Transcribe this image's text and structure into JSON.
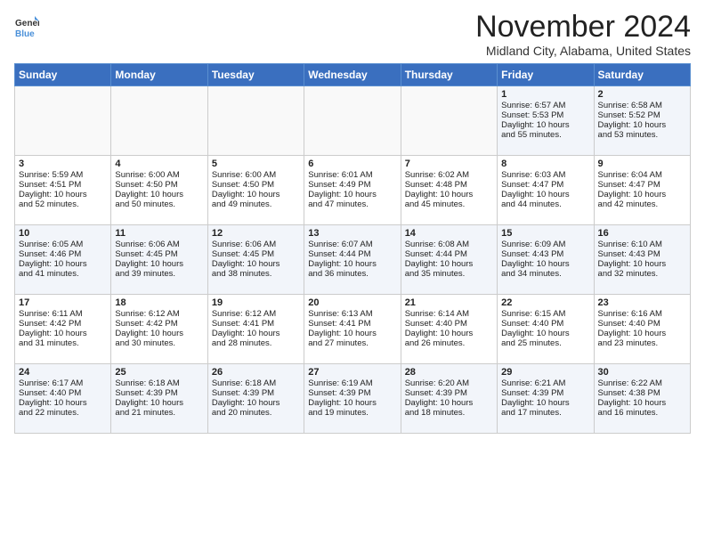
{
  "header": {
    "logo_line1": "General",
    "logo_line2": "Blue",
    "month": "November 2024",
    "location": "Midland City, Alabama, United States"
  },
  "days_of_week": [
    "Sunday",
    "Monday",
    "Tuesday",
    "Wednesday",
    "Thursday",
    "Friday",
    "Saturday"
  ],
  "weeks": [
    [
      {
        "day": "",
        "lines": []
      },
      {
        "day": "",
        "lines": []
      },
      {
        "day": "",
        "lines": []
      },
      {
        "day": "",
        "lines": []
      },
      {
        "day": "",
        "lines": []
      },
      {
        "day": "1",
        "lines": [
          "Sunrise: 6:57 AM",
          "Sunset: 5:53 PM",
          "Daylight: 10 hours",
          "and 55 minutes."
        ]
      },
      {
        "day": "2",
        "lines": [
          "Sunrise: 6:58 AM",
          "Sunset: 5:52 PM",
          "Daylight: 10 hours",
          "and 53 minutes."
        ]
      }
    ],
    [
      {
        "day": "3",
        "lines": [
          "Sunrise: 5:59 AM",
          "Sunset: 4:51 PM",
          "Daylight: 10 hours",
          "and 52 minutes."
        ]
      },
      {
        "day": "4",
        "lines": [
          "Sunrise: 6:00 AM",
          "Sunset: 4:50 PM",
          "Daylight: 10 hours",
          "and 50 minutes."
        ]
      },
      {
        "day": "5",
        "lines": [
          "Sunrise: 6:00 AM",
          "Sunset: 4:50 PM",
          "Daylight: 10 hours",
          "and 49 minutes."
        ]
      },
      {
        "day": "6",
        "lines": [
          "Sunrise: 6:01 AM",
          "Sunset: 4:49 PM",
          "Daylight: 10 hours",
          "and 47 minutes."
        ]
      },
      {
        "day": "7",
        "lines": [
          "Sunrise: 6:02 AM",
          "Sunset: 4:48 PM",
          "Daylight: 10 hours",
          "and 45 minutes."
        ]
      },
      {
        "day": "8",
        "lines": [
          "Sunrise: 6:03 AM",
          "Sunset: 4:47 PM",
          "Daylight: 10 hours",
          "and 44 minutes."
        ]
      },
      {
        "day": "9",
        "lines": [
          "Sunrise: 6:04 AM",
          "Sunset: 4:47 PM",
          "Daylight: 10 hours",
          "and 42 minutes."
        ]
      }
    ],
    [
      {
        "day": "10",
        "lines": [
          "Sunrise: 6:05 AM",
          "Sunset: 4:46 PM",
          "Daylight: 10 hours",
          "and 41 minutes."
        ]
      },
      {
        "day": "11",
        "lines": [
          "Sunrise: 6:06 AM",
          "Sunset: 4:45 PM",
          "Daylight: 10 hours",
          "and 39 minutes."
        ]
      },
      {
        "day": "12",
        "lines": [
          "Sunrise: 6:06 AM",
          "Sunset: 4:45 PM",
          "Daylight: 10 hours",
          "and 38 minutes."
        ]
      },
      {
        "day": "13",
        "lines": [
          "Sunrise: 6:07 AM",
          "Sunset: 4:44 PM",
          "Daylight: 10 hours",
          "and 36 minutes."
        ]
      },
      {
        "day": "14",
        "lines": [
          "Sunrise: 6:08 AM",
          "Sunset: 4:44 PM",
          "Daylight: 10 hours",
          "and 35 minutes."
        ]
      },
      {
        "day": "15",
        "lines": [
          "Sunrise: 6:09 AM",
          "Sunset: 4:43 PM",
          "Daylight: 10 hours",
          "and 34 minutes."
        ]
      },
      {
        "day": "16",
        "lines": [
          "Sunrise: 6:10 AM",
          "Sunset: 4:43 PM",
          "Daylight: 10 hours",
          "and 32 minutes."
        ]
      }
    ],
    [
      {
        "day": "17",
        "lines": [
          "Sunrise: 6:11 AM",
          "Sunset: 4:42 PM",
          "Daylight: 10 hours",
          "and 31 minutes."
        ]
      },
      {
        "day": "18",
        "lines": [
          "Sunrise: 6:12 AM",
          "Sunset: 4:42 PM",
          "Daylight: 10 hours",
          "and 30 minutes."
        ]
      },
      {
        "day": "19",
        "lines": [
          "Sunrise: 6:12 AM",
          "Sunset: 4:41 PM",
          "Daylight: 10 hours",
          "and 28 minutes."
        ]
      },
      {
        "day": "20",
        "lines": [
          "Sunrise: 6:13 AM",
          "Sunset: 4:41 PM",
          "Daylight: 10 hours",
          "and 27 minutes."
        ]
      },
      {
        "day": "21",
        "lines": [
          "Sunrise: 6:14 AM",
          "Sunset: 4:40 PM",
          "Daylight: 10 hours",
          "and 26 minutes."
        ]
      },
      {
        "day": "22",
        "lines": [
          "Sunrise: 6:15 AM",
          "Sunset: 4:40 PM",
          "Daylight: 10 hours",
          "and 25 minutes."
        ]
      },
      {
        "day": "23",
        "lines": [
          "Sunrise: 6:16 AM",
          "Sunset: 4:40 PM",
          "Daylight: 10 hours",
          "and 23 minutes."
        ]
      }
    ],
    [
      {
        "day": "24",
        "lines": [
          "Sunrise: 6:17 AM",
          "Sunset: 4:40 PM",
          "Daylight: 10 hours",
          "and 22 minutes."
        ]
      },
      {
        "day": "25",
        "lines": [
          "Sunrise: 6:18 AM",
          "Sunset: 4:39 PM",
          "Daylight: 10 hours",
          "and 21 minutes."
        ]
      },
      {
        "day": "26",
        "lines": [
          "Sunrise: 6:18 AM",
          "Sunset: 4:39 PM",
          "Daylight: 10 hours",
          "and 20 minutes."
        ]
      },
      {
        "day": "27",
        "lines": [
          "Sunrise: 6:19 AM",
          "Sunset: 4:39 PM",
          "Daylight: 10 hours",
          "and 19 minutes."
        ]
      },
      {
        "day": "28",
        "lines": [
          "Sunrise: 6:20 AM",
          "Sunset: 4:39 PM",
          "Daylight: 10 hours",
          "and 18 minutes."
        ]
      },
      {
        "day": "29",
        "lines": [
          "Sunrise: 6:21 AM",
          "Sunset: 4:39 PM",
          "Daylight: 10 hours",
          "and 17 minutes."
        ]
      },
      {
        "day": "30",
        "lines": [
          "Sunrise: 6:22 AM",
          "Sunset: 4:38 PM",
          "Daylight: 10 hours",
          "and 16 minutes."
        ]
      }
    ]
  ]
}
